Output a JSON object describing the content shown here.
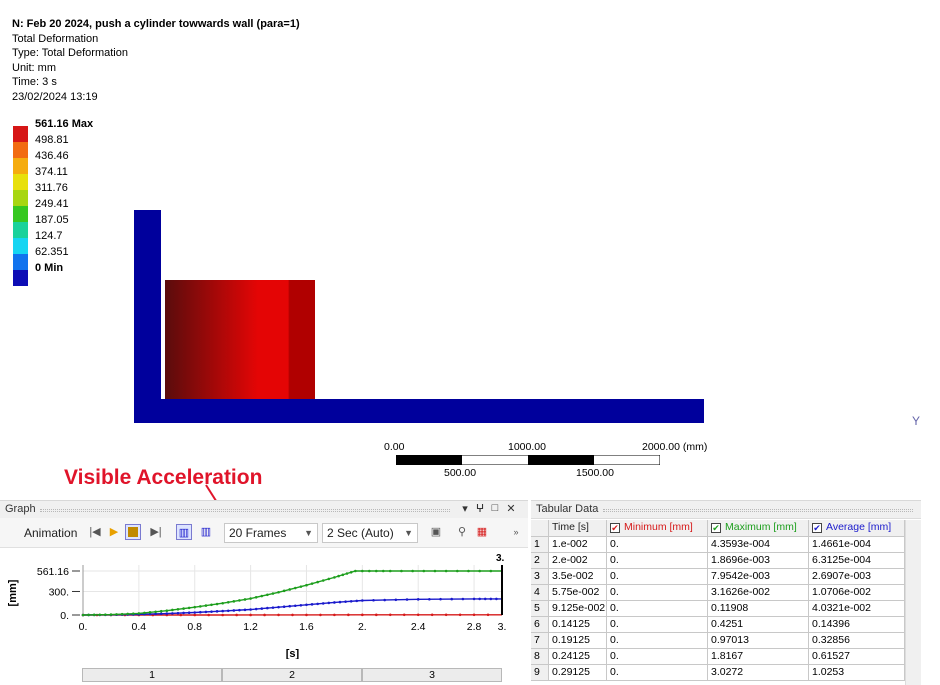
{
  "result": {
    "title": "N: Feb 20 2024, push a cylinder towwards wall (para=1)",
    "lines": [
      "Total Deformation",
      "Type: Total Deformation",
      "Unit: mm",
      "Time: 3 s",
      "23/02/2024 13:19"
    ]
  },
  "legend": {
    "entries": [
      {
        "label": "561.16 Max",
        "color": "#d61616",
        "bold": true
      },
      {
        "label": "498.81",
        "color": "#f26b11"
      },
      {
        "label": "436.46",
        "color": "#f5ac0f"
      },
      {
        "label": "374.11",
        "color": "#e8e00c"
      },
      {
        "label": "311.76",
        "color": "#a7d611"
      },
      {
        "label": "249.41",
        "color": "#36c820"
      },
      {
        "label": "187.05",
        "color": "#1ad29b"
      },
      {
        "label": "124.7",
        "color": "#16d5f2"
      },
      {
        "label": "62.351",
        "color": "#1173ee"
      },
      {
        "label": "0 Min",
        "color": "#0d0db5",
        "bold": true
      }
    ]
  },
  "model": {
    "wall_color": "#00009c",
    "cylinder_color_dark": "#5a0c0c",
    "cylinder_color_mid": "#e40505",
    "cylinder_color_band": "#b00000"
  },
  "ruler": {
    "top_labels": [
      "0.00",
      "1000.00",
      "2000.00 (mm)"
    ],
    "bottom_labels": [
      "500.00",
      "1500.00"
    ]
  },
  "axis_triad_label": "Y",
  "annotation": {
    "text": "Visible Acceleration",
    "color": "#e0142a"
  },
  "graph": {
    "title": "Graph",
    "controls": [
      "▾",
      "ⵖ",
      "□",
      "✕"
    ],
    "toolbar": {
      "animation_label": "Animation",
      "frames_value": "20 Frames",
      "duration_value": "2 Sec (Auto)"
    }
  },
  "chart_data": {
    "type": "line",
    "xlabel": "[s]",
    "ylabel": "[mm]",
    "xlim": [
      0,
      3
    ],
    "ylim": [
      0,
      561.16
    ],
    "xticks": [
      "0.",
      "0.4",
      "0.8",
      "1.2",
      "1.6",
      "2.",
      "2.4",
      "2.8",
      "3."
    ],
    "yticks": [
      "0.",
      "300.",
      "561.16"
    ],
    "marker_label": "3.",
    "series": [
      {
        "name": "Maximum [mm]",
        "color": "#1d9e1d",
        "x": [
          0,
          0.2,
          0.4,
          0.6,
          0.8,
          1.0,
          1.2,
          1.4,
          1.6,
          1.8,
          1.95,
          2.2,
          2.6,
          3.0
        ],
        "y": [
          0,
          5,
          20,
          55,
          100,
          150,
          210,
          290,
          380,
          480,
          561.16,
          561.16,
          561.16,
          561.16
        ]
      },
      {
        "name": "Average [mm]",
        "color": "#1a1acc",
        "x": [
          0,
          0.2,
          0.4,
          0.6,
          0.8,
          1.0,
          1.2,
          1.4,
          1.6,
          1.8,
          2.0,
          2.4,
          2.8,
          3.0
        ],
        "y": [
          0,
          2,
          8,
          18,
          32,
          50,
          70,
          100,
          130,
          160,
          185,
          200,
          205,
          205
        ]
      },
      {
        "name": "Minimum [mm]",
        "color": "#d61a1a",
        "x": [
          0,
          0.5,
          1.0,
          1.5,
          2.0,
          2.5,
          3.0
        ],
        "y": [
          0,
          0,
          0,
          1,
          2,
          3,
          3
        ]
      }
    ]
  },
  "timeline": {
    "segments": [
      "1",
      "2",
      "3"
    ]
  },
  "tabular": {
    "title": "Tabular Data",
    "headers": [
      "Time [s]",
      "Minimum [mm]",
      "Maximum [mm]",
      "Average [mm]"
    ],
    "header_colors": [
      "#222222",
      "#d61a1a",
      "#1d9e1d",
      "#1a1acc"
    ],
    "rows": [
      [
        "1",
        "1.e-002",
        "0.",
        "4.3593e-004",
        "1.4661e-004"
      ],
      [
        "2",
        "2.e-002",
        "0.",
        "1.8696e-003",
        "6.3125e-004"
      ],
      [
        "3",
        "3.5e-002",
        "0.",
        "7.9542e-003",
        "2.6907e-003"
      ],
      [
        "4",
        "5.75e-002",
        "0.",
        "3.1626e-002",
        "1.0706e-002"
      ],
      [
        "5",
        "9.125e-002",
        "0.",
        "0.11908",
        "4.0321e-002"
      ],
      [
        "6",
        "0.14125",
        "0.",
        "0.4251",
        "0.14396"
      ],
      [
        "7",
        "0.19125",
        "0.",
        "0.97013",
        "0.32856"
      ],
      [
        "8",
        "0.24125",
        "0.",
        "1.8167",
        "0.61527"
      ],
      [
        "9",
        "0.29125",
        "0.",
        "3.0272",
        "1.0253"
      ]
    ]
  }
}
